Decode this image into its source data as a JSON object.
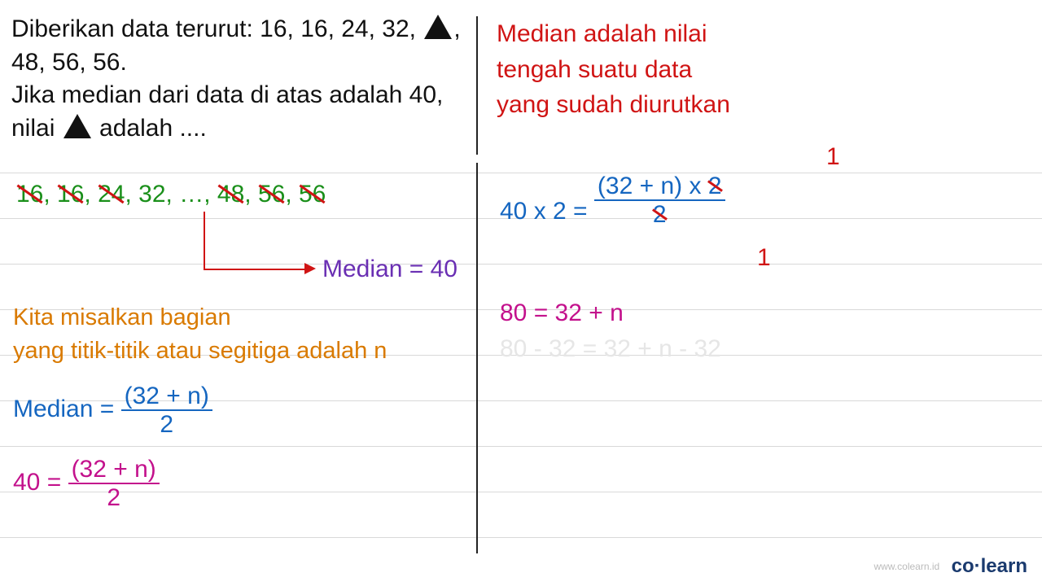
{
  "problem": {
    "line1_a": "Diberikan data terurut: 16, 16, 24, 32, ",
    "line1_b": ",",
    "line2": "48, 56, 56.",
    "line3": "Jika median dari data di atas adalah 40,",
    "line4_a": "nilai ",
    "line4_b": " adalah ...."
  },
  "note_right": {
    "l1": "Median adalah nilai",
    "l2": "tengah suatu data",
    "l3": "yang sudah diurutkan"
  },
  "data_list": {
    "a": "16",
    "b": "16",
    "c": "24",
    "d": "32,",
    "dots": "…,",
    "e": "48",
    "f": "56",
    "g": "56"
  },
  "median_label": "Median = 40",
  "assume": {
    "l1": "Kita misalkan bagian",
    "l2": "yang titik-titik atau segitiga adalah n"
  },
  "eq1": {
    "lhs": "Median = ",
    "num": "(32 + n)",
    "den": "2"
  },
  "eq2": {
    "lhs": "40 = ",
    "num": "(32 + n)",
    "den": "2"
  },
  "right_eq1": {
    "lhs": "40 x 2 = ",
    "num_a": "(32 + n) x ",
    "num_b": "2",
    "den": "2",
    "one": "1"
  },
  "right_eq2": "80 = 32 + n",
  "right_eq3": "80 - 32 = 32 + n - 32",
  "brand": {
    "url": "www.colearn.id",
    "logo": "co·learn"
  }
}
